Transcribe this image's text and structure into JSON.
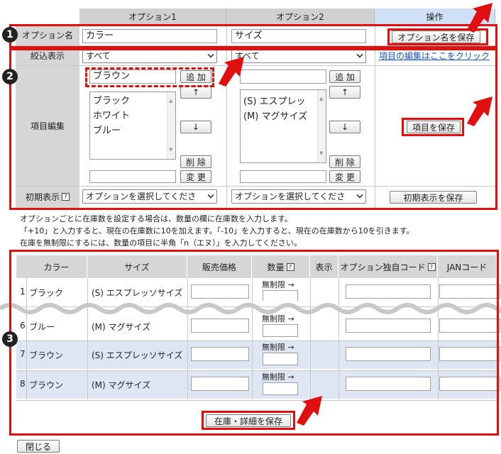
{
  "top_table": {
    "headers": {
      "option1": "オプション1",
      "option2": "オプション2",
      "operation": "操作"
    },
    "row_option_name": {
      "label": "オプション名",
      "option1_value": "カラー",
      "option2_value": "サイズ",
      "save_button": "オプション名を保存"
    },
    "row_filter": {
      "label": "絞込表示",
      "option1_selected": "すべて",
      "option2_selected": "すべて",
      "edit_link": "項目の編集はここをクリック"
    },
    "row_items": {
      "label": "項目編集",
      "option1_new_item": "ブラウン",
      "option1_list": [
        "ブラック",
        "ホワイト",
        "ブルー"
      ],
      "option2_new_item": "",
      "option2_list": [
        "(S) エスプレッ",
        "(M) マグサイズ"
      ],
      "add_button": "追 加",
      "up_button": "↑",
      "down_button": "↓",
      "delete_button": "削 除",
      "change_button": "変 更",
      "save_items_button": "項目を保存"
    },
    "row_initial": {
      "label": "初期表示",
      "option1_selected": "オプションを選択してくださ",
      "option2_selected": "オプションを選択してくださ",
      "save_initial_button": "初期表示を保存"
    }
  },
  "notes": [
    "オプションごとに在庫数を設定する場合は、数量の欄に在庫数を入力します。",
    "「+10」と入力すると、現在の在庫数に10を加えます。「-10」を入力すると、現在の在庫数から10を引きます。",
    "在庫を無制限にするには、数量の項目に半角「n（エヌ）」を入力してください。"
  ],
  "stock_table": {
    "headers": [
      "カラー",
      "サイズ",
      "販売価格",
      "数量",
      "表示",
      "オプション独自コード",
      "JANコード"
    ],
    "rows": [
      {
        "no": "1",
        "color": "ブラック",
        "size": "(S) エスプレッソサイズ",
        "qty": "無制限 →"
      },
      {
        "no": "6",
        "color": "ブルー",
        "size": "(M) マグサイズ",
        "qty": "無制限 →"
      },
      {
        "no": "7",
        "color": "ブラウン",
        "size": "(S) エスプレッソサイズ",
        "qty": "無制限 →"
      },
      {
        "no": "8",
        "color": "ブラウン",
        "size": "(M) マグサイズ",
        "qty": "無制限 →"
      }
    ],
    "save_button": "在庫・詳細を保存"
  },
  "close_button": "閉じる",
  "step_badges": [
    "1",
    "2",
    "3"
  ],
  "help_icon": "?",
  "colors": {
    "highlight": "#e01010",
    "header_gray": "#d6d6d6",
    "operation_blue": "#cfe0f7",
    "row_blue": "#dfe6f3",
    "link": "#1a55cc"
  },
  "icons": [
    "question-icon",
    "red-arrow-icon",
    "wavy-break-icon",
    "chevron-down-icon"
  ]
}
